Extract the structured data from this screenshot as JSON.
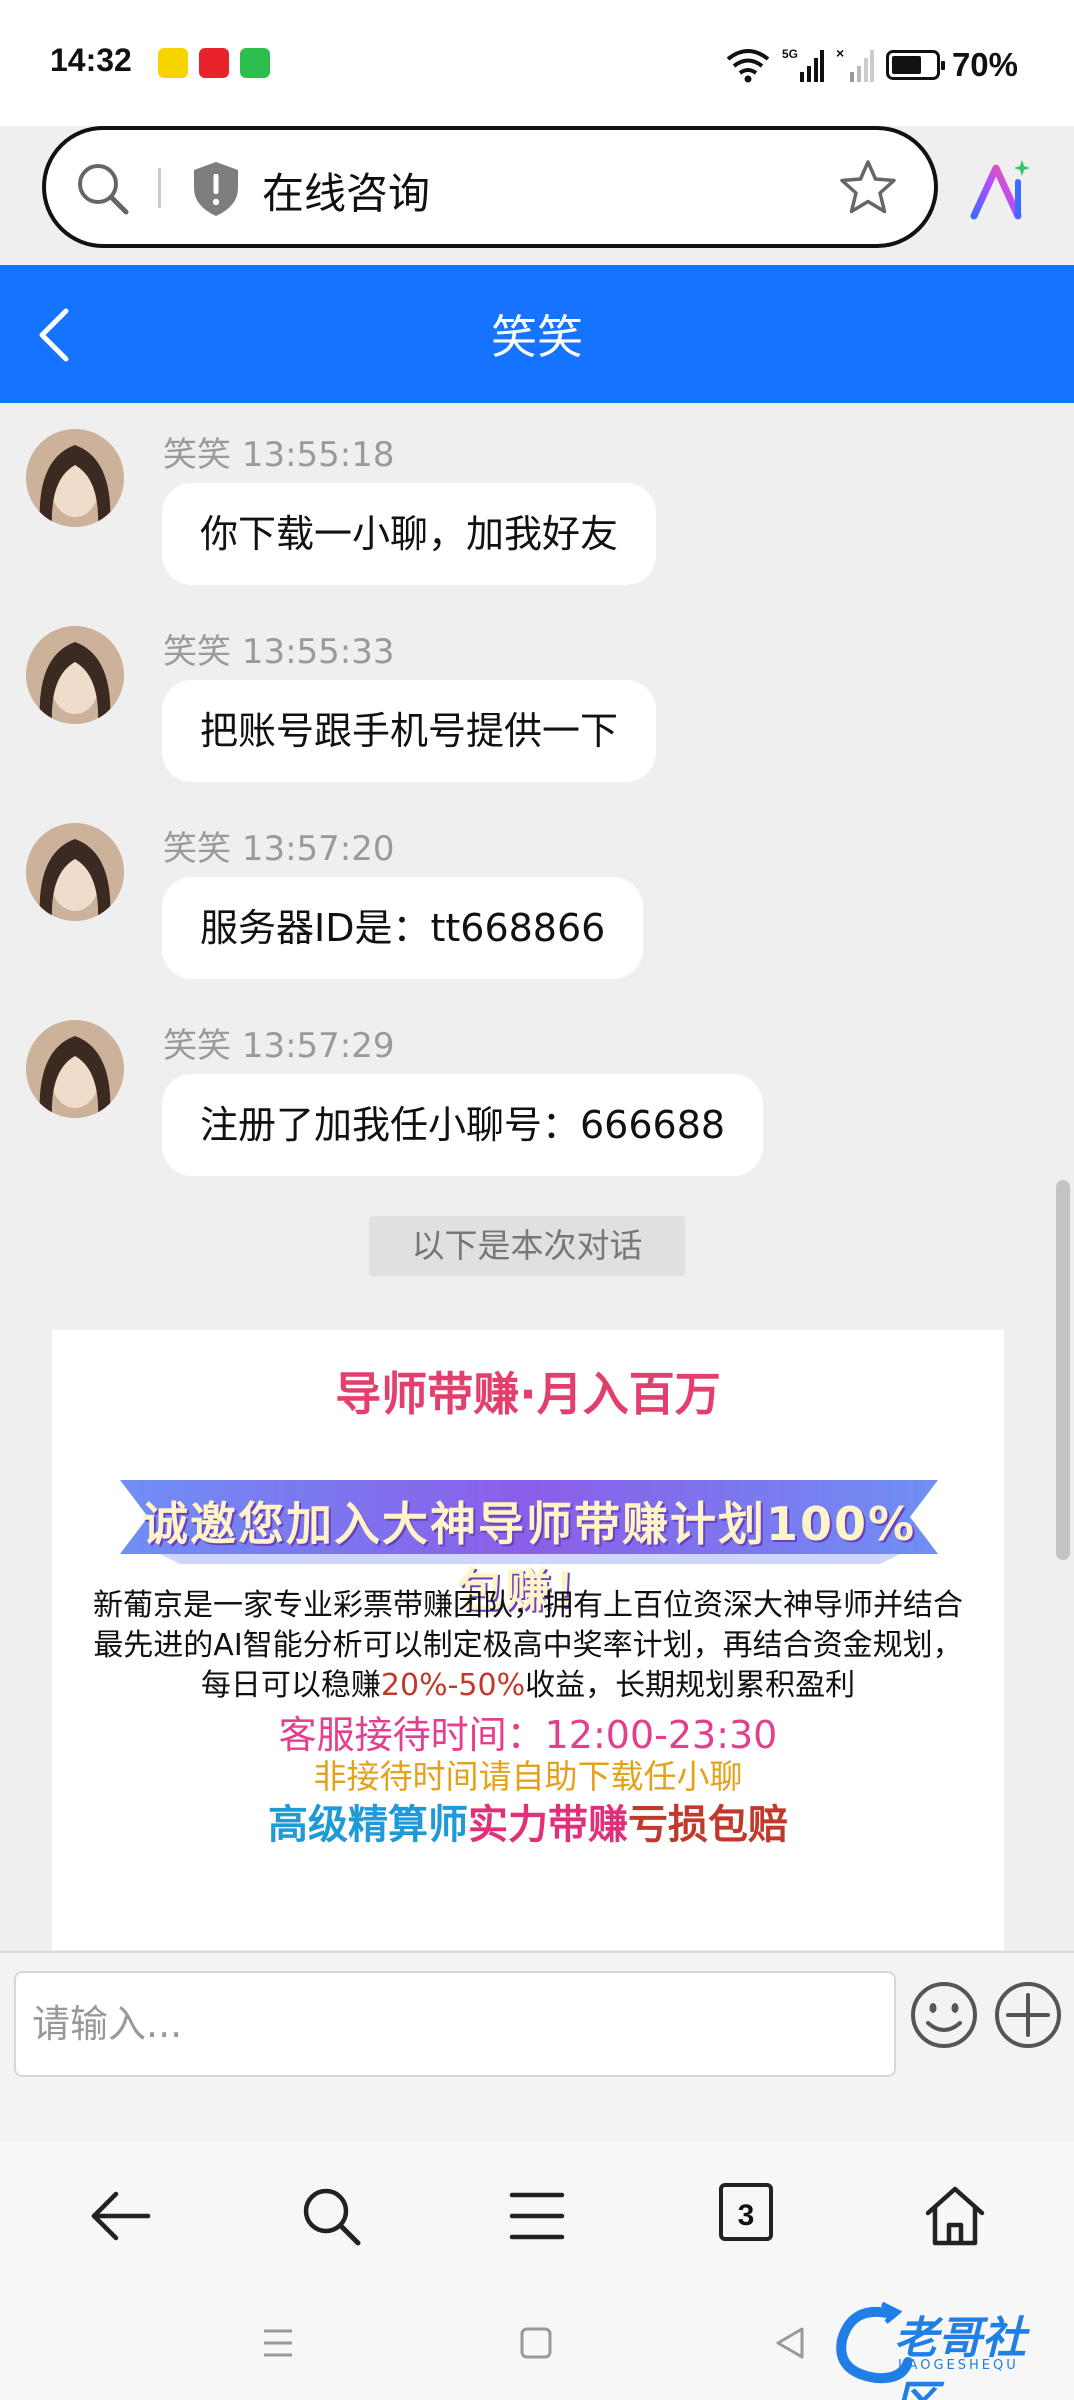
{
  "status_bar": {
    "time": "14:32",
    "battery_percent_label": "70%",
    "battery_level": 0.7
  },
  "address_bar": {
    "title": "在线咨询"
  },
  "chat": {
    "title": "笑笑",
    "messages": [
      {
        "sender": "笑笑",
        "time": "13:55:18",
        "text": "你下载一小聊，加我好友"
      },
      {
        "sender": "笑笑",
        "time": "13:55:33",
        "text": "把账号跟手机号提供一下"
      },
      {
        "sender": "笑笑",
        "time": "13:57:20",
        "text": "服务器ID是：tt668866"
      },
      {
        "sender": "笑笑",
        "time": "13:57:29",
        "text": "注册了加我任小聊号：666688"
      }
    ],
    "divider_label": "以下是本次对话"
  },
  "promo": {
    "title": "导师带赚·月入百万",
    "banner": "诚邀您加入大神导师带赚计划100%包赚！",
    "body_line1": "新葡京是一家专业彩票带赚团队，拥有上百位资深大神导师并结合",
    "body_line2": "最先进的AI智能分析可以制定极高中奖率计划，再结合资金规划，",
    "body_line3_pre": "每日可以稳赚",
    "body_line3_highlight": "20%-50%",
    "body_line3_post": "收益，长期规划累积盈利",
    "hours": "客服接待时间：12:00-23:30",
    "off_hours": "非接待时间请自助下载任小聊",
    "slogan_part1": "高级精算师",
    "slogan_part2": "实力带赚",
    "slogan_part3": "亏损包赔"
  },
  "input": {
    "placeholder": "请输入..."
  },
  "toolbar": {
    "tab_count": "3"
  },
  "watermark": {
    "text": "老哥社区",
    "sub": "LAOGESHEQU"
  },
  "colors": {
    "header_blue": "#1473ff",
    "promo_pink": "#e23f6d",
    "slogan_blue": "#1f9ad6",
    "off_hours_orange": "#e4a11b"
  }
}
